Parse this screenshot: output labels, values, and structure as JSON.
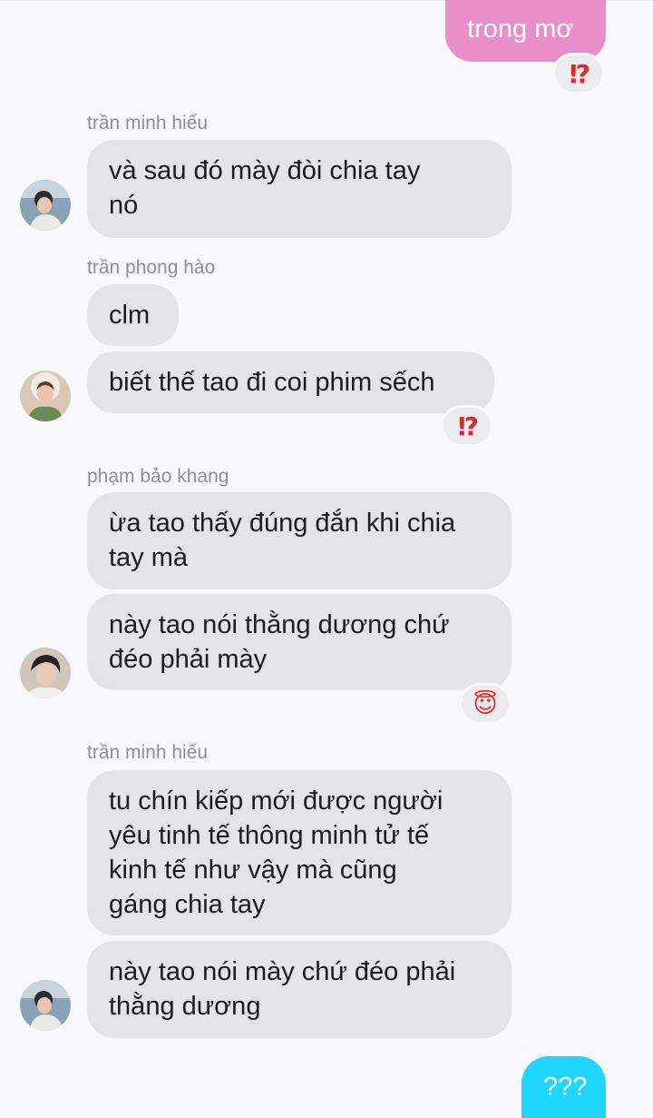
{
  "messages": [
    {
      "id": "m1",
      "side": "sent",
      "text": "trong mơ",
      "reaction": "⁉"
    },
    {
      "id": "m2",
      "sender": "trần minh hiếu",
      "text": "và sau đó mày đòi chia tay\nnó"
    },
    {
      "id": "m3",
      "sender": "trần phong hào",
      "text": "clm"
    },
    {
      "id": "m4",
      "text": "biết thế tao đi coi phim sếch",
      "reaction": "⁉"
    },
    {
      "id": "m5",
      "sender": "phạm bảo khang",
      "text": "ừa tao thấy đúng đắn khi chia\ntay mà"
    },
    {
      "id": "m6",
      "text": "này tao nói thằng dương chứ\nđéo phải mày",
      "reaction": "😇"
    },
    {
      "id": "m7",
      "sender": "trần minh hiếu",
      "text": "tu chín kiếp mới được người\nyêu tinh tế thông minh tử tế\nkinh tế như vậy mà cũng\ngáng chia tay"
    },
    {
      "id": "m8",
      "text": "này tao nói mày chứ đéo phải\nthằng dương"
    },
    {
      "id": "m9",
      "side": "sent",
      "text": "???"
    }
  ],
  "colors": {
    "sent_pink": "#e88fc9",
    "sent_blue": "#1fd6ff",
    "received": "#e4e4e6",
    "background": "#f8f8fa"
  }
}
